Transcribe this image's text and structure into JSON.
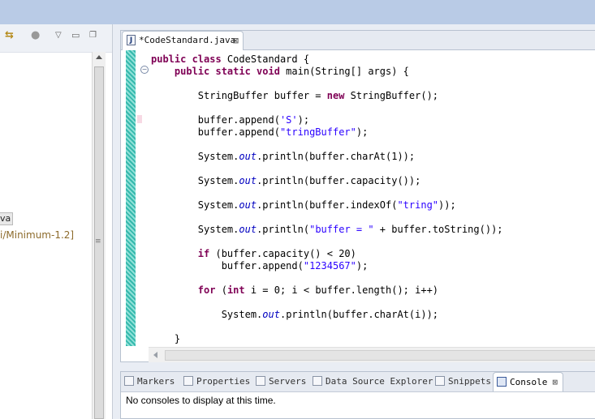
{
  "left_panel": {
    "toolbar": {
      "link_icon": "link-with-editor-icon",
      "view_menu_icon": "view-menu-icon",
      "minimize_icon": "minimize-icon",
      "maximize_icon": "maximize-icon"
    },
    "tree_items": [
      "va",
      "i/Minimum-1.2]"
    ]
  },
  "editor": {
    "tab_title": "*CodeStandard.java",
    "tab_icon_letter": "J",
    "close_glyph": "⊠",
    "fold_glyph": "−",
    "code_lines": [
      [
        {
          "t": "public class ",
          "c": "kw"
        },
        {
          "t": "CodeStandard {",
          "c": ""
        }
      ],
      [
        {
          "t": "    public static void ",
          "c": "kw"
        },
        {
          "t": "main(String[] args) {",
          "c": ""
        }
      ],
      [],
      [
        {
          "t": "        StringBuffer buffer = ",
          "c": ""
        },
        {
          "t": "new ",
          "c": "kw"
        },
        {
          "t": "StringBuffer();",
          "c": ""
        }
      ],
      [],
      [
        {
          "t": "        buffer.append(",
          "c": ""
        },
        {
          "t": "'S'",
          "c": "st"
        },
        {
          "t": ");",
          "c": ""
        }
      ],
      [
        {
          "t": "        buffer.append(",
          "c": ""
        },
        {
          "t": "\"tringBuffer\"",
          "c": "st"
        },
        {
          "t": ");",
          "c": ""
        }
      ],
      [],
      [
        {
          "t": "        System.",
          "c": ""
        },
        {
          "t": "out",
          "c": "fi"
        },
        {
          "t": ".println(buffer.charAt(1));",
          "c": ""
        }
      ],
      [],
      [
        {
          "t": "        System.",
          "c": ""
        },
        {
          "t": "out",
          "c": "fi"
        },
        {
          "t": ".println(buffer.capacity());",
          "c": ""
        }
      ],
      [],
      [
        {
          "t": "        System.",
          "c": ""
        },
        {
          "t": "out",
          "c": "fi"
        },
        {
          "t": ".println(buffer.indexOf(",
          "c": ""
        },
        {
          "t": "\"tring\"",
          "c": "st"
        },
        {
          "t": "));",
          "c": ""
        }
      ],
      [],
      [
        {
          "t": "        System.",
          "c": ""
        },
        {
          "t": "out",
          "c": "fi"
        },
        {
          "t": ".println(",
          "c": ""
        },
        {
          "t": "\"buffer = \"",
          "c": "st"
        },
        {
          "t": " + buffer.toString());",
          "c": ""
        }
      ],
      [],
      [
        {
          "t": "        ",
          "c": ""
        },
        {
          "t": "if ",
          "c": "kw"
        },
        {
          "t": "(buffer.capacity() < 20)",
          "c": ""
        }
      ],
      [
        {
          "t": "            buffer.append(",
          "c": ""
        },
        {
          "t": "\"1234567\"",
          "c": "st"
        },
        {
          "t": ");",
          "c": ""
        }
      ],
      [],
      [
        {
          "t": "        ",
          "c": ""
        },
        {
          "t": "for ",
          "c": "kw"
        },
        {
          "t": "(",
          "c": ""
        },
        {
          "t": "int ",
          "c": "kw"
        },
        {
          "t": "i = 0; i < buffer.length(); i++)",
          "c": ""
        }
      ],
      [],
      [
        {
          "t": "            System.",
          "c": ""
        },
        {
          "t": "out",
          "c": "fi"
        },
        {
          "t": ".println(buffer.charAt(i));",
          "c": ""
        }
      ],
      [],
      [
        {
          "t": "    }",
          "c": ""
        }
      ]
    ]
  },
  "bottom_panel": {
    "tabs": [
      {
        "label": "Markers",
        "icon": "markers-icon",
        "active": false
      },
      {
        "label": "Properties",
        "icon": "properties-icon",
        "active": false
      },
      {
        "label": "Servers",
        "icon": "servers-icon",
        "active": false
      },
      {
        "label": "Data Source Explorer",
        "icon": "data-source-explorer-icon",
        "active": false
      },
      {
        "label": "Snippets",
        "icon": "snippets-icon",
        "active": false
      },
      {
        "label": "Console",
        "icon": "console-icon",
        "active": true
      }
    ],
    "message": "No consoles to display at this time."
  },
  "colors": {
    "keyword": "#7f0055",
    "string": "#2a00ff",
    "field": "#0000c0",
    "change_bar": "#36b9ad"
  }
}
